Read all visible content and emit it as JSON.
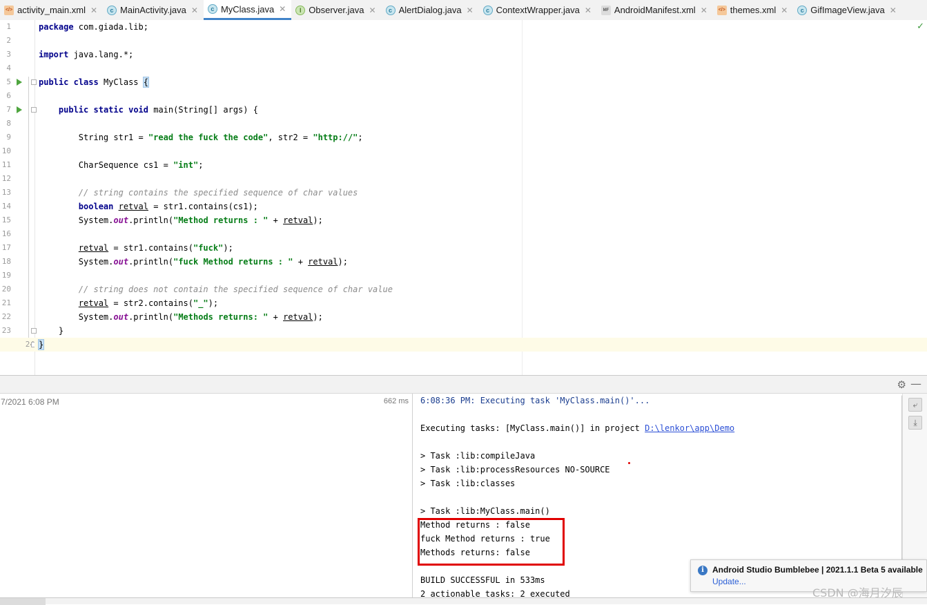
{
  "tabs": [
    {
      "label": "activity_main.xml",
      "icon": "xml-file-icon",
      "active": false
    },
    {
      "label": "MainActivity.java",
      "icon": "java-class-icon",
      "active": false
    },
    {
      "label": "MyClass.java",
      "icon": "java-class-icon",
      "active": true
    },
    {
      "label": "Observer.java",
      "icon": "java-interface-icon",
      "active": false
    },
    {
      "label": "AlertDialog.java",
      "icon": "java-class-icon",
      "active": false
    },
    {
      "label": "ContextWrapper.java",
      "icon": "java-class-icon",
      "active": false
    },
    {
      "label": "AndroidManifest.xml",
      "icon": "manifest-file-icon",
      "active": false
    },
    {
      "label": "themes.xml",
      "icon": "xml-file-icon",
      "active": false
    },
    {
      "label": "GifImageView.java",
      "icon": "java-class-icon",
      "active": false
    }
  ],
  "editor": {
    "line_numbers": [
      "1",
      "2",
      "3",
      "4",
      "5",
      "6",
      "7",
      "8",
      "9",
      "10",
      "11",
      "12",
      "13",
      "14",
      "15",
      "16",
      "17",
      "18",
      "19",
      "20",
      "21",
      "22",
      "23",
      "24"
    ],
    "code": {
      "l1_kw": "package",
      "l1_rest": " com.giada.lib;",
      "l3_kw": "import",
      "l3_rest": " java.lang.*;",
      "l5_kw1": "public",
      "l5_kw2": "class",
      "l5_name": " MyClass ",
      "l5_brace": "{",
      "l7_kw1": "public",
      "l7_kw2": "static",
      "l7_kw3": "void",
      "l7_rest": " main(String[] args) {",
      "l9_a": "String str1 = ",
      "l9_s1": "\"read the fuck the code\"",
      "l9_b": ", str2 = ",
      "l9_s2": "\"http://\"",
      "l9_c": ";",
      "l11_a": "CharSequence cs1 = ",
      "l11_s": "\"int\"",
      "l11_b": ";",
      "l13_cmt": "// string contains the specified sequence of char values",
      "l14_kw": "boolean",
      "l14_var": "retval",
      "l14_rest": " = str1.contains(cs1);",
      "l15_a": "System.",
      "l15_out": "out",
      "l15_b": ".println(",
      "l15_s": "\"Method returns : \"",
      "l15_c": " + ",
      "l15_var": "retval",
      "l15_d": ");",
      "l17_var": "retval",
      "l17_a": " = str1.contains(",
      "l17_s": "\"fuck\"",
      "l17_b": ");",
      "l18_a": "System.",
      "l18_out": "out",
      "l18_b": ".println(",
      "l18_s": "\"fuck Method returns : \"",
      "l18_c": " + ",
      "l18_var": "retval",
      "l18_d": ");",
      "l20_cmt": "// string does not contain the specified sequence of char value",
      "l21_var": "retval",
      "l21_a": " = str2.contains(",
      "l21_s": "\"_\"",
      "l21_b": ");",
      "l22_a": "System.",
      "l22_out": "out",
      "l22_b": ".println(",
      "l22_s": "\"Methods returns: \"",
      "l22_c": " + ",
      "l22_var": "retval",
      "l22_d": ");",
      "l23": "}",
      "l24": "}"
    }
  },
  "run_panel": {
    "tree_date": "7/2021 6:08 PM",
    "tree_duration": "662 ms",
    "console": {
      "line1": "6:08:36 PM: Executing task 'MyClass.main()'...",
      "line2_a": "Executing tasks: [MyClass.main()] in project ",
      "line2_link": "D:\\lenkor\\app\\Demo",
      "line3": "> Task :lib:compileJava",
      "line4": "> Task :lib:processResources NO-SOURCE",
      "line5": "> Task :lib:classes",
      "line6": "> Task :lib:MyClass.main()",
      "line7": "Method returns : false",
      "line8": "fuck Method returns : true",
      "line9": "Methods returns: false",
      "line10": "BUILD SUCCESSFUL in 533ms",
      "line11": "2 actionable tasks: 2 executed"
    }
  },
  "notification": {
    "title": "Android Studio Bumblebee | 2021.1.1 Beta 5 available",
    "link": "Update..."
  },
  "watermark": "CSDN @海月汐辰",
  "colors": {
    "keyword": "#00008b",
    "string": "#067d17",
    "comment": "#8c8c8c",
    "field": "#871094",
    "highlight_box": "#e00000"
  }
}
